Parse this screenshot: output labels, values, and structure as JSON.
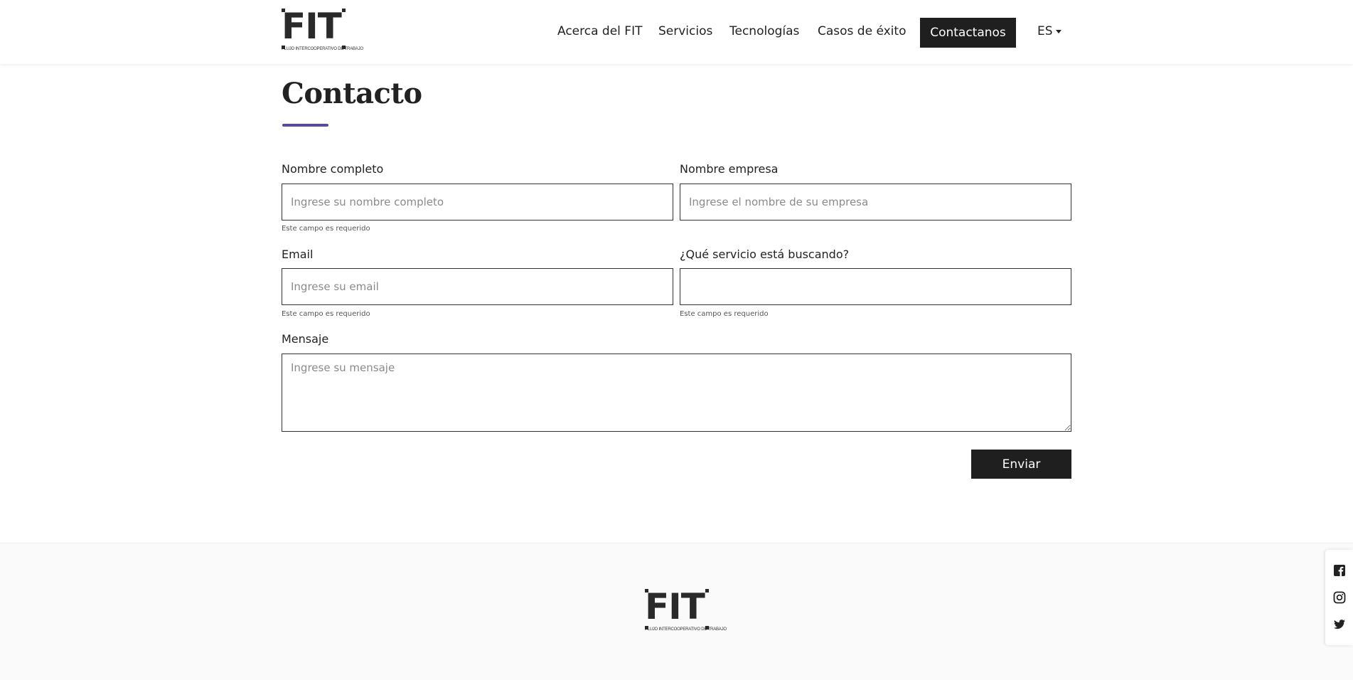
{
  "header": {
    "logo": {
      "brand": "FIT",
      "tagline": "FLUJO INTERCOOPERATIVO DE TRABAJO"
    },
    "nav": [
      {
        "label": "Acerca del FIT"
      },
      {
        "label": "Servicios"
      },
      {
        "label": "Tecnologías"
      },
      {
        "label": "Casos de éxito"
      }
    ],
    "cta_label": "Contactanos",
    "language": "ES"
  },
  "main": {
    "title": "Contacto",
    "form": {
      "nombre": {
        "label": "Nombre completo",
        "placeholder": "Ingrese su nombre completo",
        "value": "",
        "hint": "Este campo es requerido"
      },
      "empresa": {
        "label": "Nombre empresa",
        "placeholder": "Ingrese el nombre de su empresa",
        "value": ""
      },
      "email": {
        "label": "Email",
        "placeholder": "Ingrese su email",
        "value": "",
        "hint": "Este campo es requerido"
      },
      "servicio": {
        "label": "¿Qué servicio está buscando?",
        "value": "",
        "hint": "Este campo es requerido"
      },
      "mensaje": {
        "label": "Mensaje",
        "placeholder": "Ingrese su mensaje",
        "value": ""
      },
      "submit_label": "Enviar"
    }
  },
  "footer": {
    "logo": {
      "brand": "FIT",
      "tagline": "FLUJO INTERCOOPERATIVO DE TRABAJO"
    }
  },
  "social": [
    "facebook-icon",
    "instagram-icon",
    "twitter-icon"
  ],
  "colors": {
    "accent": "#5b4a9b",
    "button": "#1f1f1f",
    "footer_bg": "#fafafa"
  }
}
